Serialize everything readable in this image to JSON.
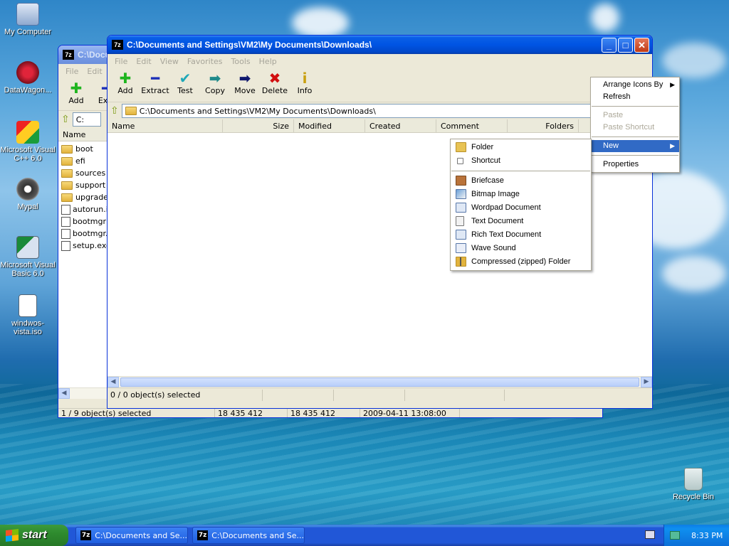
{
  "desktop": {
    "icons": [
      {
        "label": "My Computer",
        "icon": "my-computer-icon"
      },
      {
        "label": "DataWagon...",
        "icon": "datawagon-icon"
      },
      {
        "label": "Microsoft Visual C++ 6.0",
        "icon": "visual-cpp-icon"
      },
      {
        "label": "Mypal",
        "icon": "mypal-icon"
      },
      {
        "label": "Microsoft Visual Basic 6.0",
        "icon": "visual-basic-icon"
      },
      {
        "label": "windwos-vista.iso",
        "icon": "iso-file-icon"
      },
      {
        "label": "Recycle Bin",
        "icon": "recycle-bin-icon"
      }
    ]
  },
  "back_window": {
    "title": "C:\\Docu",
    "menu": [
      "File",
      "Edit"
    ],
    "toolbar": [
      "Add",
      "Extr"
    ],
    "address": "C:",
    "column_name": "Name",
    "files": [
      {
        "name": "boot",
        "type": "folder"
      },
      {
        "name": "efi",
        "type": "folder"
      },
      {
        "name": "sources",
        "type": "folder"
      },
      {
        "name": "support",
        "type": "folder"
      },
      {
        "name": "upgrade",
        "type": "folder"
      },
      {
        "name": "autorun.in",
        "type": "file"
      },
      {
        "name": "bootmgr",
        "type": "file"
      },
      {
        "name": "bootmgr.e",
        "type": "file"
      },
      {
        "name": "setup.exe",
        "type": "file"
      }
    ],
    "status": [
      "1 / 9 object(s) selected",
      "18 435 412",
      "18 435 412",
      "2009-04-11 13:08:00"
    ]
  },
  "front_window": {
    "app_icon_text": "7z",
    "title": "C:\\Documents and Settings\\VM2\\My Documents\\Downloads\\",
    "menu": [
      "File",
      "Edit",
      "View",
      "Favorites",
      "Tools",
      "Help"
    ],
    "toolbar": [
      {
        "label": "Add",
        "icon": "add-icon",
        "glyph": "✚",
        "color": "#1fb51f"
      },
      {
        "label": "Extract",
        "icon": "extract-icon",
        "glyph": "━",
        "color": "#1c2fb8"
      },
      {
        "label": "Test",
        "icon": "test-icon",
        "glyph": "✔",
        "color": "#1fa8b8"
      },
      {
        "label": "Copy",
        "icon": "copy-icon",
        "glyph": "➡",
        "color": "#1f8a8a"
      },
      {
        "label": "Move",
        "icon": "move-icon",
        "glyph": "➡",
        "color": "#10186e"
      },
      {
        "label": "Delete",
        "icon": "delete-icon",
        "glyph": "✖",
        "color": "#d10f0f"
      },
      {
        "label": "Info",
        "icon": "info-icon",
        "glyph": "i",
        "color": "#c9a010"
      }
    ],
    "address": "C:\\Documents and Settings\\VM2\\My Documents\\Downloads\\",
    "columns": [
      "Name",
      "Size",
      "Modified",
      "Created",
      "Comment",
      "Folders"
    ],
    "status": "0 / 0 object(s) selected"
  },
  "context_menu": {
    "items": [
      {
        "label": "Arrange Icons By",
        "submenu": true,
        "disabled": false
      },
      {
        "label": "Refresh",
        "submenu": false,
        "disabled": false
      },
      {
        "sep": true
      },
      {
        "label": "Paste",
        "submenu": false,
        "disabled": true
      },
      {
        "label": "Paste Shortcut",
        "submenu": false,
        "disabled": true
      },
      {
        "sep": true
      },
      {
        "label": "New",
        "submenu": true,
        "disabled": false,
        "selected": true
      },
      {
        "sep": true
      },
      {
        "label": "Properties",
        "submenu": false,
        "disabled": false
      }
    ]
  },
  "new_submenu": {
    "items": [
      {
        "label": "Folder",
        "icon": "folder-icon",
        "color": "#e8c354"
      },
      {
        "label": "Shortcut",
        "icon": "shortcut-icon",
        "color": "#ffffff"
      },
      {
        "sep": true
      },
      {
        "label": "Briefcase",
        "icon": "briefcase-icon",
        "color": "#b9733a"
      },
      {
        "label": "Bitmap Image",
        "icon": "bitmap-image-icon",
        "color": "#6aa0d8"
      },
      {
        "label": "Wordpad Document",
        "icon": "wordpad-document-icon",
        "color": "#dfe8f5"
      },
      {
        "label": "Text Document",
        "icon": "text-document-icon",
        "color": "#f2f2f2"
      },
      {
        "label": "Rich Text Document",
        "icon": "rich-text-document-icon",
        "color": "#dfe8f5"
      },
      {
        "label": "Wave Sound",
        "icon": "wave-sound-icon",
        "color": "#e9eef8"
      },
      {
        "label": "Compressed (zipped) Folder",
        "icon": "zipped-folder-icon",
        "color": "#e2b33c"
      }
    ]
  },
  "taskbar": {
    "start_label": "start",
    "tasks": [
      "C:\\Documents and Se...",
      "C:\\Documents and Se..."
    ],
    "clock": "8:33 PM"
  }
}
